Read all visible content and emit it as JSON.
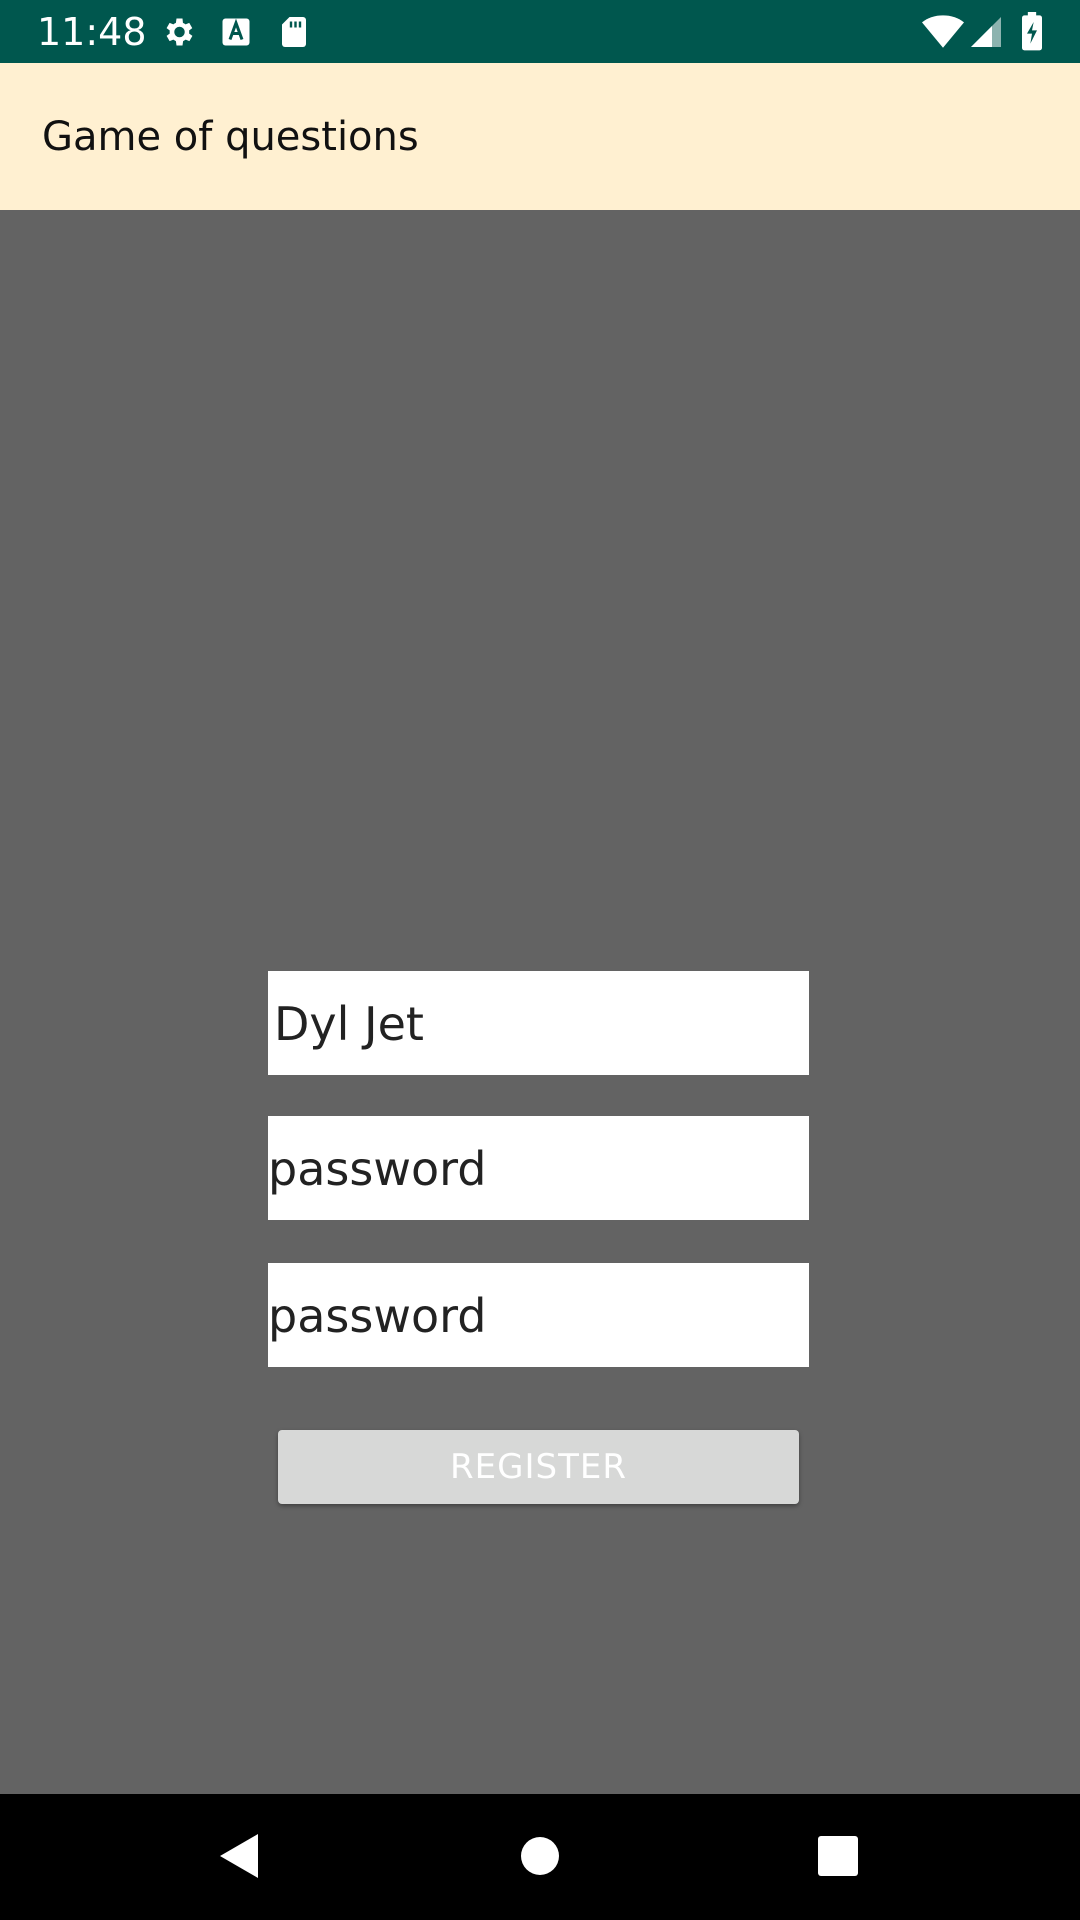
{
  "status_bar": {
    "time": "11:48",
    "icons_left": [
      "settings-icon",
      "text-input-icon",
      "sd-card-icon"
    ],
    "icons_right": [
      "wifi-icon",
      "cell-signal-icon",
      "battery-charging-icon"
    ],
    "background": "#00574e"
  },
  "app_bar": {
    "title": "Game of questions",
    "background": "#fff0d1"
  },
  "form": {
    "username_value": "Dyl Jet",
    "password_placeholder": "password",
    "confirm_password_placeholder": "password",
    "register_label": "REGISTER"
  },
  "nav_bar": {
    "buttons": [
      "back-icon",
      "home-icon",
      "recents-icon"
    ]
  },
  "colors": {
    "page_background": "#636363",
    "button_background": "#d7d8d7"
  }
}
